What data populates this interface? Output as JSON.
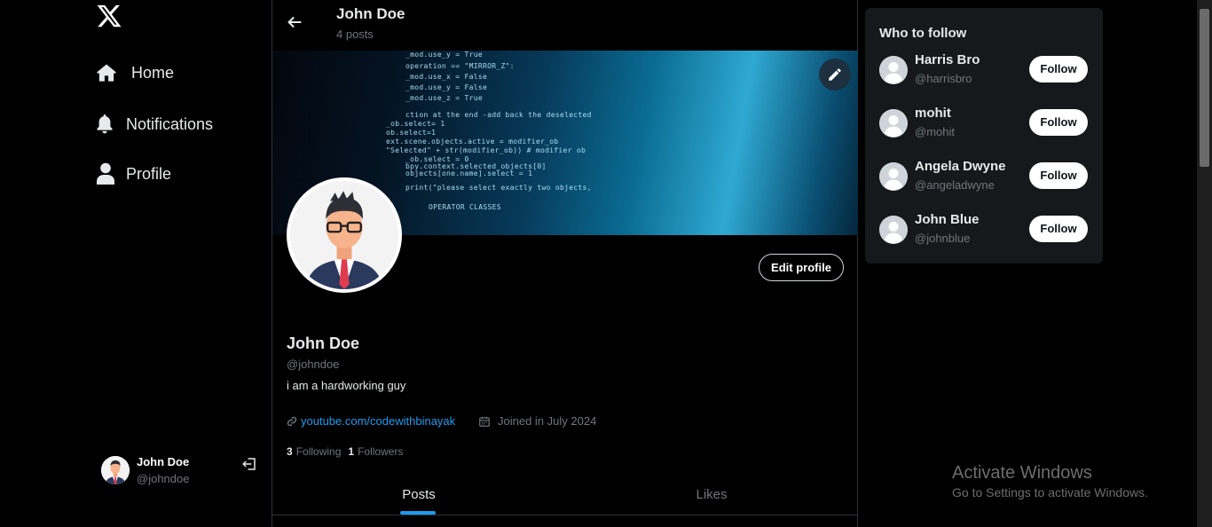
{
  "sidebar": {
    "nav": [
      {
        "label": "Home",
        "icon": "home-icon"
      },
      {
        "label": "Notifications",
        "icon": "bell-icon"
      },
      {
        "label": "Profile",
        "icon": "user-icon"
      }
    ],
    "account": {
      "name": "John Doe",
      "handle": "@johndoe"
    }
  },
  "header": {
    "title": "John Doe",
    "post_count": "4 posts"
  },
  "cover_code": [
    "_mod.use_y = True",
    "operation == \"MIRROR_Z\":",
    "_mod.use_x = False",
    "_mod.use_y = False",
    "_mod.use_z = True",
    "ction at the end -add back the deselected",
    "_ob.select= 1",
    "ob.select=1",
    "ext.scene.objects.active = modifier_ob",
    "\"Selected\" + str(modifier_ob)) # modifier ob",
    "_ob.select = 0",
    "bpy.context.selected_objects[0]",
    "objects[one.name].select = 1",
    "print(\"please select exactly two objects,",
    "OPERATOR CLASSES"
  ],
  "profile": {
    "name": "John Doe",
    "handle": "@johndoe",
    "bio": "i am a hardworking guy",
    "link": "youtube.com/codewithbinayak",
    "joined": "Joined in July 2024",
    "following_count": "3",
    "following_label": "Following",
    "followers_count": "1",
    "followers_label": "Followers",
    "edit_label": "Edit profile"
  },
  "tabs": [
    {
      "label": "Posts",
      "active": true
    },
    {
      "label": "Likes",
      "active": false
    }
  ],
  "who_to_follow": {
    "title": "Who to follow",
    "button_label": "Follow",
    "users": [
      {
        "name": "Harris Bro",
        "handle": "@harrisbro"
      },
      {
        "name": "mohit",
        "handle": "@mohit"
      },
      {
        "name": "Angela Dwyne",
        "handle": "@angeladwyne"
      },
      {
        "name": "John Blue",
        "handle": "@johnblue"
      }
    ]
  },
  "watermark": {
    "line1": "Activate Windows",
    "line2": "Go to Settings to activate Windows."
  },
  "colors": {
    "accent": "#1d9bf0",
    "background": "#000000",
    "panel": "#16181c",
    "muted": "#71767b"
  }
}
